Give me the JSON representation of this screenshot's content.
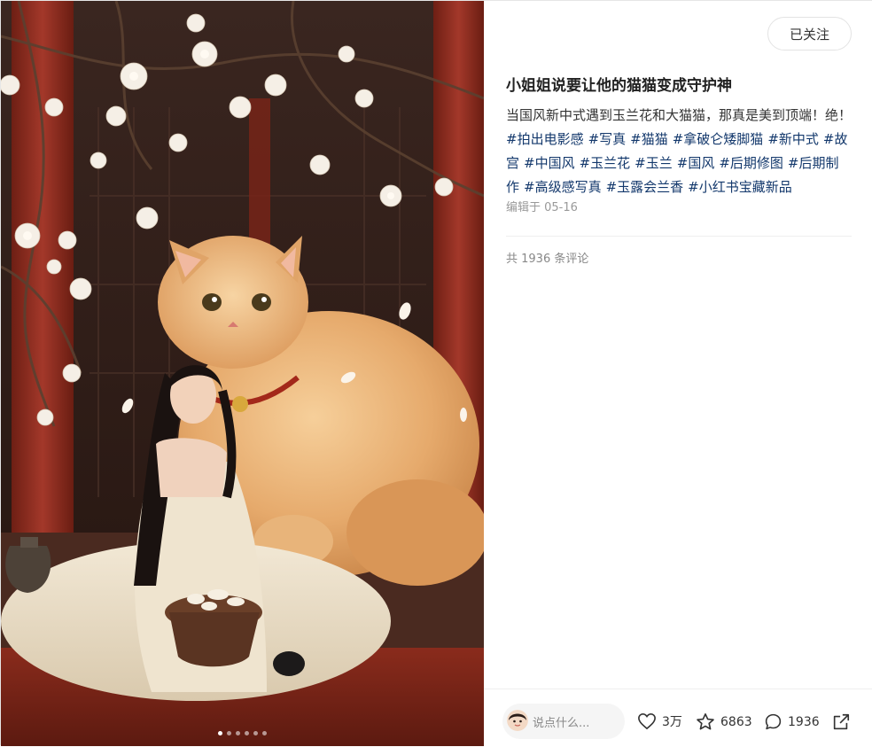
{
  "post": {
    "follow_label": "已关注",
    "title": "小姐姐说要让他的猫猫变成守护神",
    "description": "当国风新中式遇到玉兰花和大猫猫，那真是美到顶端！绝！",
    "tags": [
      "#拍出电影感",
      "#写真",
      "#猫猫",
      "#拿破仑矮脚猫",
      "#新中式",
      "#故宫",
      "#中国风",
      "#玉兰花",
      "#玉兰",
      "#国风",
      "#后期修图",
      "#后期制作",
      "#高级感写真",
      "#玉露会兰香",
      "#小红书宝藏新品"
    ],
    "edit_date": "编辑于 05-16",
    "comment_total": "共 1936 条评论"
  },
  "carousel": {
    "count": 6,
    "active_index": 0
  },
  "bottom_bar": {
    "input_placeholder": "说点什么...",
    "likes": "3万",
    "collects": "6863",
    "comments": "1936"
  },
  "icons": {
    "like": "heart-icon",
    "collect": "star-icon",
    "comment": "chat-bubble-icon",
    "share": "share-icon"
  }
}
